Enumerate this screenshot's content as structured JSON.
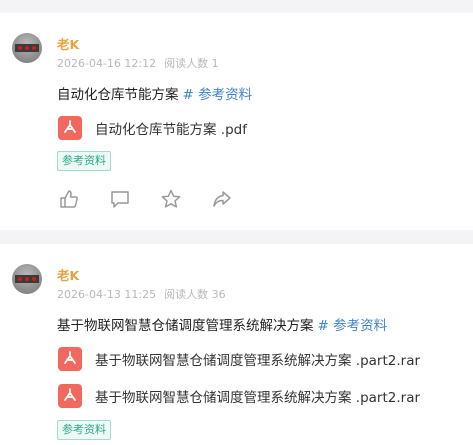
{
  "posts": [
    {
      "author": "老K",
      "date": "2026-04-16 12:12",
      "reads": "阅读人数 1",
      "title": "自动化仓库节能方案",
      "title_tag": "# 参考资料",
      "attachments": [
        {
          "name": "自动化仓库节能方案 .pdf",
          "icon": "pdf-file-icon"
        }
      ],
      "tag_chip": "参考资料",
      "actions": [
        {
          "icon": "thumbs-up-icon"
        },
        {
          "icon": "comment-icon"
        },
        {
          "icon": "star-icon"
        },
        {
          "icon": "share-icon"
        }
      ]
    },
    {
      "author": "老K",
      "date": "2026-04-13 11:25",
      "reads": "阅读人数 36",
      "title": "基于物联网智慧仓储调度管理系统解决方案",
      "title_tag": "# 参考资料",
      "attachments": [
        {
          "name": "基于物联网智慧仓储调度管理系统解决方案 .part2.rar",
          "icon": "file-icon"
        },
        {
          "name": "基于物联网智慧仓储调度管理系统解决方案 .part2.rar",
          "icon": "file-icon"
        }
      ],
      "tag_chip": "参考资料"
    }
  ],
  "colors": {
    "author": "#e8a23f",
    "tag_link": "#3d83c9",
    "file_icon": "#f1685e",
    "chip_text": "#2aa88a"
  }
}
